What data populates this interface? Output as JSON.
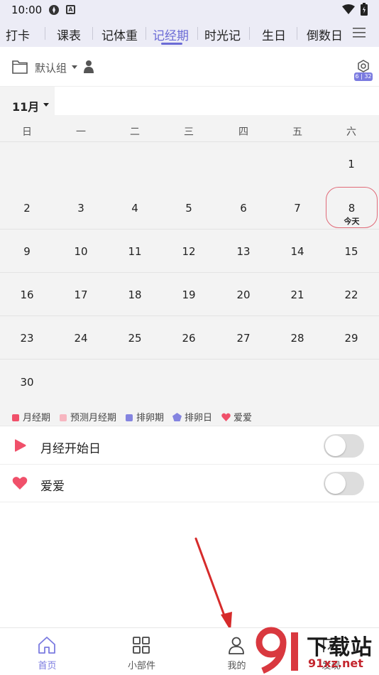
{
  "status": {
    "time": "10:00"
  },
  "tabs": [
    "打卡",
    "课表",
    "记体重",
    "记经期",
    "时光记",
    "生日",
    "倒数日"
  ],
  "active_tab": "记经期",
  "group": {
    "name": "默认组",
    "badge": "6 | 32"
  },
  "month": "11月",
  "weekdays": [
    "日",
    "一",
    "二",
    "三",
    "四",
    "五",
    "六"
  ],
  "days": [
    "1",
    "2",
    "3",
    "4",
    "5",
    "6",
    "7",
    "8",
    "9",
    "10",
    "11",
    "12",
    "13",
    "14",
    "15",
    "16",
    "17",
    "18",
    "19",
    "20",
    "21",
    "22",
    "23",
    "24",
    "25",
    "26",
    "27",
    "28",
    "29",
    "30"
  ],
  "today": {
    "day": "8",
    "label": "今天"
  },
  "legend": [
    {
      "label": "月经期",
      "color": "#f0506a"
    },
    {
      "label": "预测月经期",
      "color": "#f7b6c0"
    },
    {
      "label": "排卵期",
      "color": "#8484e0"
    },
    {
      "label": "排卵日",
      "color": "#8484e0"
    },
    {
      "label": "爱爱",
      "color": "#f0506a"
    }
  ],
  "settings": [
    {
      "label": "月经开始日",
      "icon": "play-flag-icon",
      "on": false
    },
    {
      "label": "爱爱",
      "icon": "heart-icon",
      "on": false
    }
  ],
  "nav": [
    {
      "label": "首页",
      "icon": "home-icon"
    },
    {
      "label": "小部件",
      "icon": "widgets-grid-icon"
    },
    {
      "label": "我的",
      "icon": "profile-icon"
    },
    {
      "label": "发现",
      "icon": "edit-icon"
    }
  ],
  "watermark": {
    "top": "下载站",
    "bottom": "91xz.net"
  },
  "colors": {
    "accent": "#6b6bd6",
    "period": "#f0506a",
    "today_ring": "#e06a78"
  }
}
